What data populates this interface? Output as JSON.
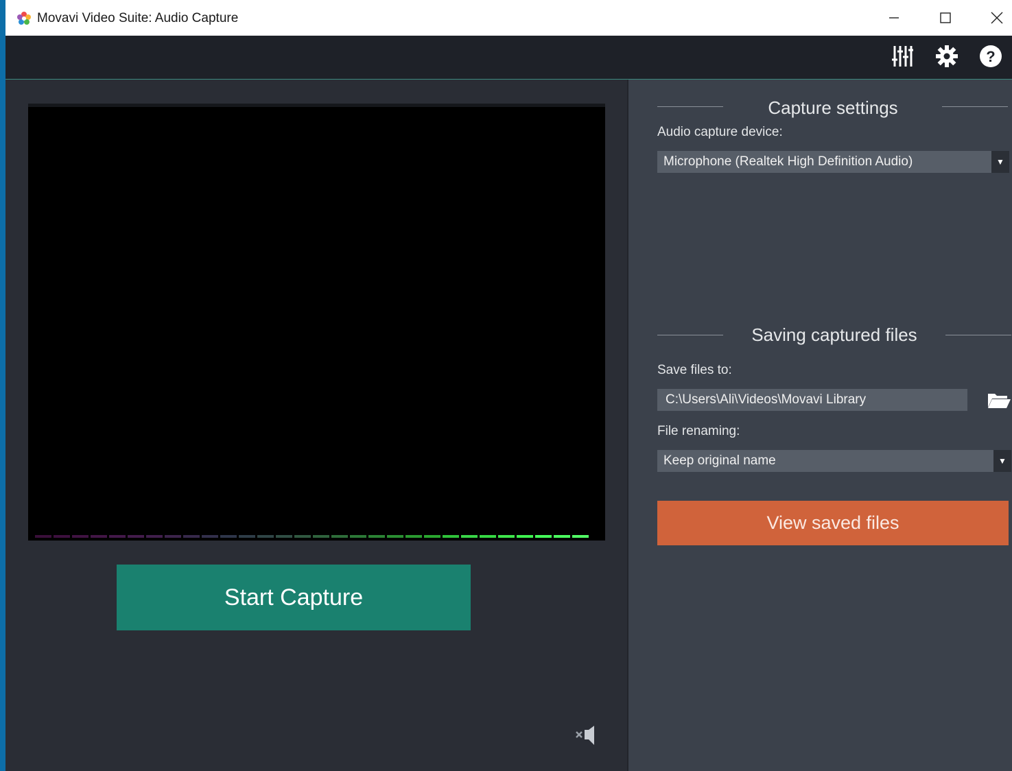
{
  "window": {
    "title": "Movavi Video Suite: Audio Capture"
  },
  "titlebar": {
    "minimize_icon": "minimize-icon",
    "maximize_icon": "maximize-icon",
    "close_icon": "close-icon"
  },
  "toolbar": {
    "mixer_icon": "sliders-icon",
    "settings_icon": "gear-icon",
    "help_icon": "help-icon"
  },
  "preview": {
    "meter_colors": [
      "#3a0f3a",
      "#3d103e",
      "#401342",
      "#421646",
      "#43194a",
      "#431c4c",
      "#401f4c",
      "#3c244b",
      "#37294b",
      "#322f4b",
      "#2e364a",
      "#2e3d48",
      "#2f4546",
      "#304e44",
      "#305840",
      "#2f633d",
      "#2e6d3a",
      "#2c7837",
      "#2b8334",
      "#2a8e32",
      "#2a9a30",
      "#2aa62f",
      "#2fc23a",
      "#39d448",
      "#36d843",
      "#3ee54b",
      "#3ef24f",
      "#45ff5a",
      "#4bff5f",
      "#52ff66"
    ]
  },
  "actions": {
    "start_capture": "Start Capture",
    "mute_icon": "speaker-mute-icon"
  },
  "capture_settings": {
    "title": "Capture settings",
    "device_label": "Audio capture device:",
    "device_value": "Microphone (Realtek High Definition Audio)"
  },
  "saving": {
    "title": "Saving captured files",
    "save_to_label": "Save files to:",
    "save_to_value": "C:\\Users\\Ali\\Videos\\Movavi Library",
    "folder_icon": "folder-open-icon",
    "renaming_label": "File renaming:",
    "renaming_value": "Keep original name",
    "view_button": "View saved files"
  },
  "colors": {
    "accent_start": "#1a816f",
    "accent_view": "#d0633b",
    "toolbar": "#1e2128"
  }
}
